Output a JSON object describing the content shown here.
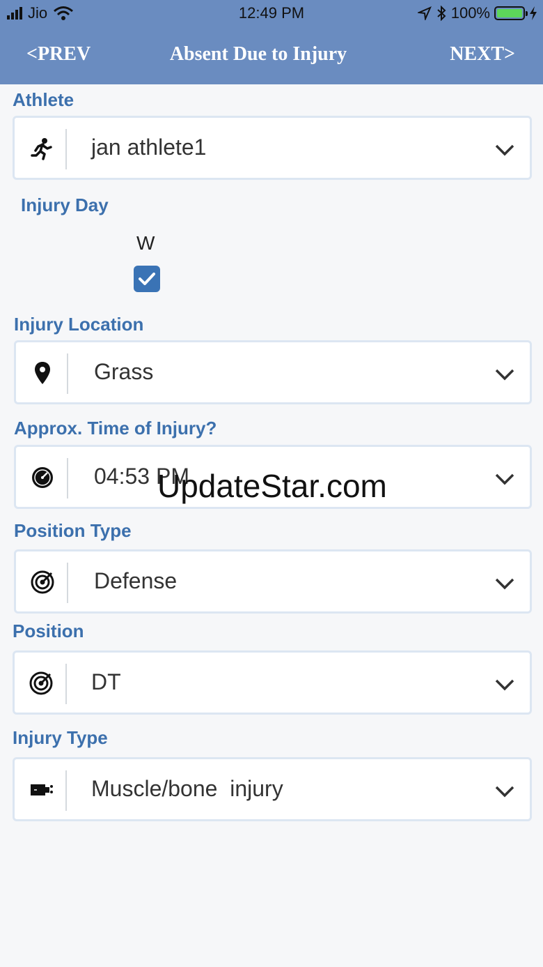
{
  "status_bar": {
    "carrier": "Jio",
    "time": "12:49 PM",
    "battery": "100%"
  },
  "nav": {
    "prev": "<PREV",
    "title": "Absent Due to Injury",
    "next": "NEXT>"
  },
  "form": {
    "athlete": {
      "label": "Athlete",
      "value": "jan athlete1",
      "icon": "runner-icon"
    },
    "injury_day": {
      "label": "Injury Day",
      "day": "W",
      "checked": true
    },
    "injury_location": {
      "label": "Injury Location",
      "value": "Grass",
      "icon": "map-pin-icon"
    },
    "time_of_injury": {
      "label": "Approx. Time of Injury?",
      "value": "04:53 PM",
      "icon": "clock-icon"
    },
    "position_type": {
      "label": "Position Type",
      "value": "Defense",
      "icon": "target-icon"
    },
    "position": {
      "label": "Position",
      "value": "DT",
      "icon": "target-icon"
    },
    "injury_type": {
      "label": "Injury Type",
      "value": "Muscle/bone  injury",
      "icon": "injury-icon"
    }
  },
  "watermark": "UpdateStar.com",
  "colors": {
    "nav_bg": "#6a8cc0",
    "label": "#3c70ad",
    "checkbox": "#3a73b5",
    "battery": "#5dd55a"
  }
}
